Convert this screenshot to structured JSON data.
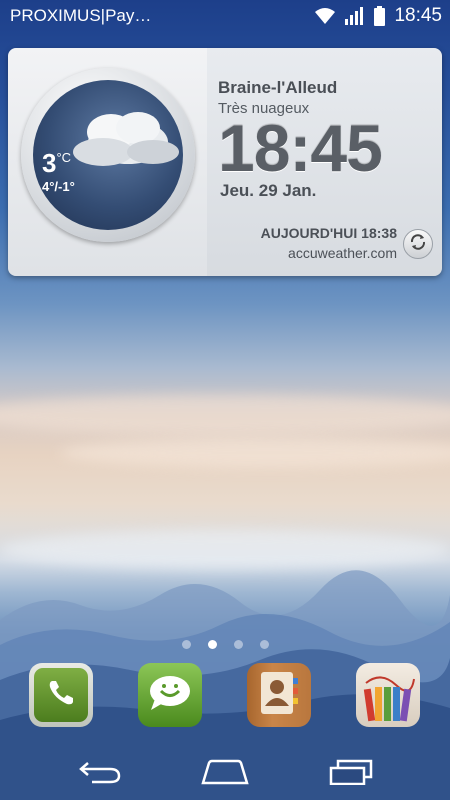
{
  "status_bar": {
    "carrier": "PROXIMUS|Pay…",
    "time": "18:45",
    "icons": [
      "wifi-icon",
      "signal-icon",
      "battery-icon"
    ]
  },
  "weather_widget": {
    "temperature": "3",
    "temperature_unit": "°C",
    "temp_range": "4°/-1°",
    "city": "Braine-l'Alleud",
    "condition": "Très nuageux",
    "clock": "18:45",
    "date": "Jeu. 29 Jan.",
    "updated": "AUJOURD'HUI 18:38",
    "source": "accuweather.com",
    "icon": "cloudy-icon"
  },
  "home": {
    "page_count": 4,
    "active_page": 2
  },
  "dock": {
    "apps": [
      {
        "name": "phone",
        "icon": "phone-icon"
      },
      {
        "name": "messaging",
        "icon": "message-icon"
      },
      {
        "name": "contacts",
        "icon": "contacts-icon"
      },
      {
        "name": "notes",
        "icon": "pencils-icon"
      }
    ]
  },
  "nav_bar": {
    "buttons": [
      "back-icon",
      "home-icon",
      "recents-icon"
    ]
  }
}
